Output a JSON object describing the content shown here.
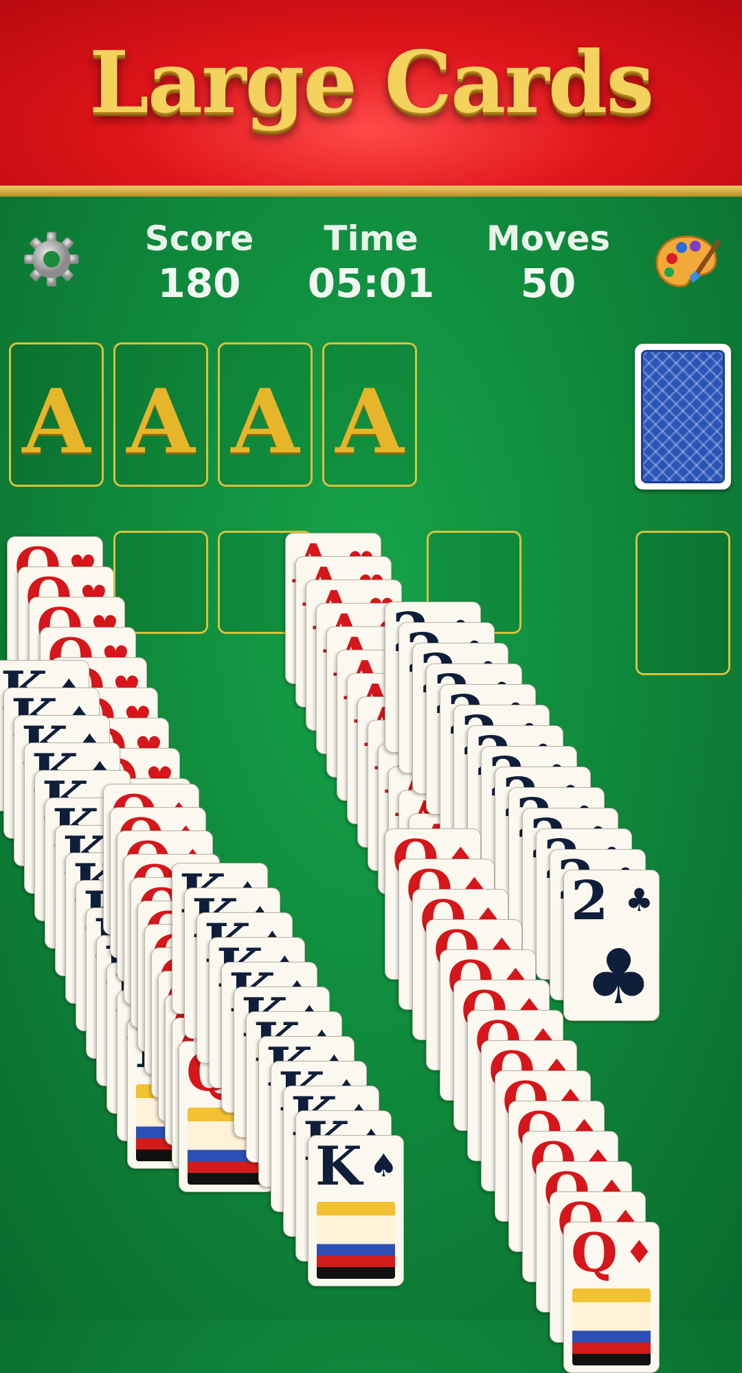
{
  "banner": {
    "title": "Large Cards"
  },
  "hud": {
    "score_label": "Score",
    "score_value": "180",
    "time_label": "Time",
    "time_value": "05:01",
    "moves_label": "Moves",
    "moves_value": "50"
  },
  "icons": {
    "settings": "gear-icon",
    "theme": "palette-icon"
  },
  "foundations": [
    {
      "label": "A"
    },
    {
      "label": "A"
    },
    {
      "label": "A"
    },
    {
      "label": "A"
    }
  ],
  "colors": {
    "felt": "#0f8a3c",
    "banner": "#e0151a",
    "gold": "#e6b52a",
    "card_back": "#2a55b8"
  },
  "cascade_waves": [
    {
      "rank": "Q",
      "suit": "♥",
      "color": "red",
      "count": 16
    },
    {
      "rank": "K",
      "suit": "♠",
      "color": "black",
      "count": 14
    },
    {
      "rank": "Q",
      "suit": "♦",
      "color": "red",
      "count": 12
    },
    {
      "rank": "A",
      "suit": "♥",
      "color": "red",
      "count": 16
    },
    {
      "rank": "2",
      "suit": "♣",
      "color": "black",
      "count": 14
    },
    {
      "rank": "K",
      "suit": "♠",
      "color": "black",
      "count": 12
    },
    {
      "rank": "Q",
      "suit": "♦",
      "color": "red",
      "count": 14
    }
  ]
}
